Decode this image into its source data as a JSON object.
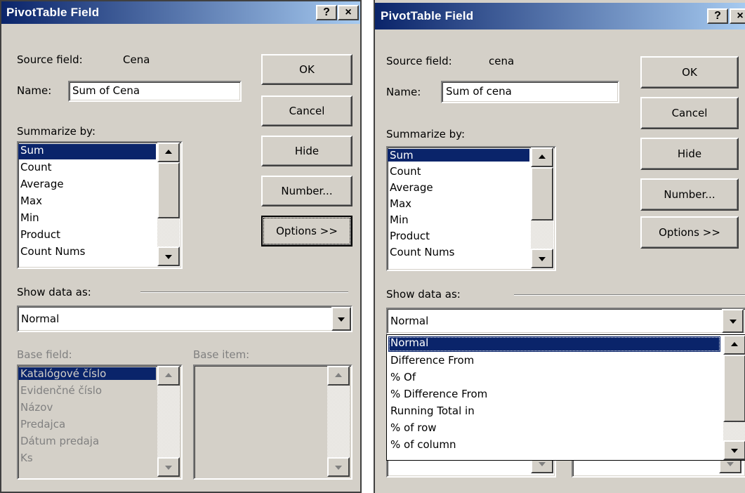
{
  "left": {
    "title": "PivotTable Field",
    "help_glyph": "?",
    "close_glyph": "×",
    "source_label": "Source field:",
    "source_value": "Cena",
    "name_label": "Name:",
    "name_value": "Sum of Cena",
    "summarize_label": "Summarize by:",
    "summarize_items": [
      "Sum",
      "Count",
      "Average",
      "Max",
      "Min",
      "Product",
      "Count Nums"
    ],
    "summarize_selected": "Sum",
    "buttons": {
      "ok": "OK",
      "cancel": "Cancel",
      "hide": "Hide",
      "number": "Number...",
      "options": "Options >>"
    },
    "show_data_label": "Show data as:",
    "show_data_value": "Normal",
    "base_field_label": "Base field:",
    "base_item_label": "Base item:",
    "base_field_items": [
      "Katalógové číslo",
      "Evidenčné číslo",
      "Názov",
      "Predajca",
      "Dátum predaja",
      "Ks"
    ],
    "base_field_selected": "Katalógové číslo"
  },
  "right": {
    "title": "PivotTable Field",
    "help_glyph": "?",
    "close_glyph": "×",
    "source_label": "Source field:",
    "source_value": "cena",
    "name_label": "Name:",
    "name_value": "Sum of cena",
    "summarize_label": "Summarize by:",
    "summarize_items": [
      "Sum",
      "Count",
      "Average",
      "Max",
      "Min",
      "Product",
      "Count Nums"
    ],
    "summarize_selected": "Sum",
    "buttons": {
      "ok": "OK",
      "cancel": "Cancel",
      "hide": "Hide",
      "number": "Number...",
      "options": "Options >>"
    },
    "show_data_label": "Show data as:",
    "show_data_value": "Normal",
    "dropdown_options": [
      "Normal",
      "Difference From",
      "% Of",
      "% Difference From",
      "Running Total in",
      "% of row",
      "% of column"
    ],
    "dropdown_highlighted": "Normal"
  },
  "colors": {
    "titlebar_start": "#0a246a",
    "titlebar_end": "#a6caf0",
    "face": "#d4d0c8",
    "selection": "#0a246a"
  }
}
